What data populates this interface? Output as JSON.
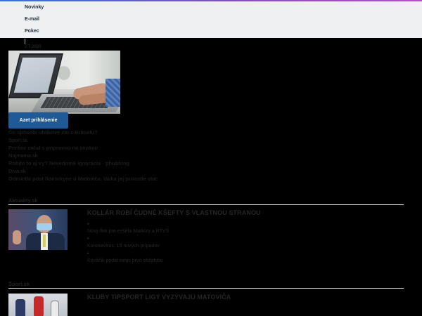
{
  "dropdown": {
    "items": [
      "Novinky",
      "E-mail",
      "Pokec"
    ]
  },
  "date_text": "2.7.2020",
  "hero": {
    "image_alt": "laptop-typing-photo"
  },
  "login_button": "Azet prihlásenie",
  "headlines": [
    {
      "title": "Čo spôsobí uhlíkové clo z Bruselu?",
      "source": "Sport.sk"
    },
    {
      "title": "Prešov začal s prípravou na sezónu",
      "source": "Najmama.sk"
    },
    {
      "title": "Robíte to aj vy? Nevedomá ignorácia - phubbing",
      "source": "Diva.sk"
    },
    {
      "title": "Odmietla post hovorkyne u Matoviča, láska jej prirastie viac",
      "source": ""
    }
  ],
  "sections": [
    {
      "name": "Aktuality.sk",
      "story_title": "KOLLÁR ROBÍ ČUDNÉ KŠEFTY S VLASTNOU STRANOU",
      "bullets": [
        "Nový flek pre exšéfa Markízy a RTVS",
        "Koronavírus: 15 nových prípadov",
        "Kováčik podal svoju prvú obžalobu"
      ]
    },
    {
      "name": "Šport.sk",
      "story_title": "KLUBY TIPSPORT LIGY VYZÝVAJÚ MATOVIČA",
      "bullets": []
    }
  ],
  "colors": {
    "accent_stripe": "#7d4fd0",
    "login_button_bg": "#1f5a96",
    "menu_bg": "#eef0f2"
  }
}
